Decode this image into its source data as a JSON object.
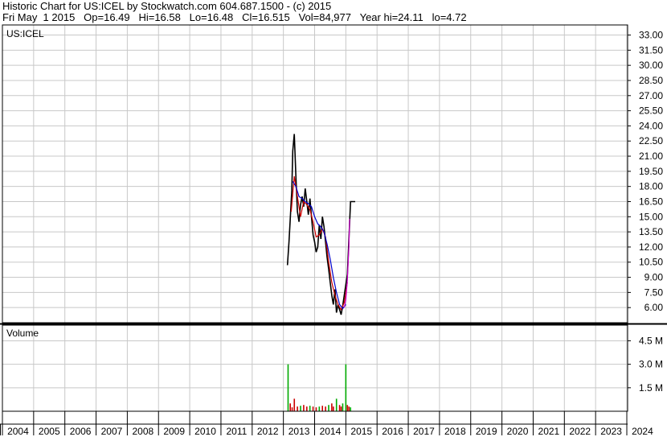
{
  "header": {
    "line1": "Historic Chart for US:ICEL by Stockwatch.com 604.687.1500 - (c) 2015",
    "line2": "Fri May  1 2015   Op=16.49   Hi=16.58   Lo=16.48   Cl=16.515   Vol=84,977   Year hi=24.11   lo=4.72"
  },
  "chart_data": [
    {
      "type": "line",
      "title": "US:ICEL",
      "ylim": [
        4.5,
        34
      ],
      "y_ticks": [
        "33.00",
        "31.50",
        "30.00",
        "28.50",
        "27.00",
        "25.50",
        "24.00",
        "22.50",
        "21.00",
        "19.50",
        "18.00",
        "16.50",
        "15.00",
        "13.50",
        "12.00",
        "10.50",
        "9.00",
        "7.50",
        "6.00"
      ],
      "x_ticks": [
        "2004",
        "2005",
        "2006",
        "2007",
        "2008",
        "2009",
        "2010",
        "2011",
        "2012",
        "2013",
        "2014",
        "2015",
        "2016",
        "2017",
        "2018",
        "2019",
        "2020",
        "2021",
        "2022",
        "2023",
        "2024"
      ],
      "series": [
        {
          "color": "#000000",
          "x": [
            2013.13,
            2013.18,
            2013.22,
            2013.27,
            2013.3,
            2013.35,
            2013.4,
            2013.45,
            2013.5,
            2013.55,
            2013.6,
            2013.65,
            2013.7,
            2013.75,
            2013.8,
            2013.85,
            2013.9,
            2013.95,
            2014.0,
            2014.05,
            2014.1,
            2014.15,
            2014.2,
            2014.25,
            2014.3,
            2014.35,
            2014.4,
            2014.45,
            2014.5,
            2014.55,
            2014.6,
            2014.65,
            2014.7,
            2014.75,
            2014.8,
            2014.85,
            2014.9,
            2015.0,
            2015.05,
            2015.15,
            2015.3
          ],
          "values": [
            10.2,
            12.5,
            14.8,
            17.6,
            21.5,
            23.2,
            19.0,
            15.5,
            14.5,
            16.2,
            17.0,
            16.0,
            17.8,
            16.5,
            15.2,
            16.8,
            15.0,
            13.2,
            12.5,
            11.5,
            12.0,
            14.2,
            12.8,
            15.0,
            14.0,
            12.5,
            11.0,
            9.8,
            8.5,
            7.2,
            6.3,
            7.8,
            5.5,
            6.3,
            5.8,
            5.3,
            6.2,
            8.3,
            9.3,
            16.5,
            16.5
          ]
        },
        {
          "color": "#cc0000",
          "x": [
            2013.25,
            2013.35,
            2013.45,
            2013.55,
            2013.65,
            2013.75,
            2013.85,
            2013.95,
            2014.05,
            2014.15,
            2014.25,
            2014.35,
            2014.45,
            2014.55,
            2014.65,
            2014.75,
            2014.85,
            2014.95,
            2015.05
          ],
          "values": [
            15.5,
            19.0,
            17.0,
            15.0,
            16.5,
            16.2,
            15.7,
            14.5,
            13.0,
            13.2,
            13.8,
            13.0,
            10.5,
            8.5,
            7.2,
            6.3,
            5.8,
            6.5,
            8.5
          ]
        },
        {
          "color": "#0000cc",
          "x": [
            2013.3,
            2013.4,
            2013.5,
            2013.6,
            2013.7,
            2013.8,
            2013.9,
            2014.0,
            2014.1,
            2014.2,
            2014.3,
            2014.4,
            2014.5,
            2014.6,
            2014.7,
            2014.8,
            2014.9,
            2015.0
          ],
          "values": [
            18.5,
            18.0,
            17.0,
            16.8,
            16.5,
            16.3,
            16.0,
            15.0,
            14.3,
            14.0,
            13.5,
            12.3,
            10.8,
            9.0,
            7.5,
            6.3,
            5.9,
            6.3
          ]
        },
        {
          "color": "#cc00cc",
          "x": [
            2014.95,
            2015.0,
            2015.05,
            2015.1,
            2015.12
          ],
          "values": [
            6.0,
            6.8,
            8.8,
            12.0,
            14.8
          ]
        }
      ]
    },
    {
      "type": "bar",
      "title": "Volume",
      "ylim": [
        0,
        5.5
      ],
      "y_ticks": [
        "4.5 M",
        "3.0 M",
        "1.5 M"
      ],
      "x": [
        2013.15,
        2013.22,
        2013.28,
        2013.35,
        2013.45,
        2013.55,
        2013.65,
        2013.75,
        2013.85,
        2013.95,
        2014.05,
        2014.15,
        2014.25,
        2014.35,
        2014.45,
        2014.55,
        2014.6,
        2014.7,
        2014.8,
        2014.85,
        2014.9,
        2015.0,
        2015.05,
        2015.1,
        2015.15
      ],
      "values": [
        3.0,
        0.5,
        0.25,
        0.8,
        0.3,
        0.35,
        0.4,
        0.3,
        0.35,
        0.3,
        0.25,
        0.3,
        0.35,
        0.3,
        0.4,
        0.5,
        0.3,
        0.8,
        0.4,
        0.3,
        0.5,
        3.0,
        0.4,
        0.3,
        0.25
      ],
      "colors": [
        "#00aa00",
        "#cc0000",
        "#cc0000",
        "#cc0000",
        "#cc0000",
        "#00aa00",
        "#cc0000",
        "#cc0000",
        "#00aa00",
        "#cc0000",
        "#cc0000",
        "#00aa00",
        "#cc0000",
        "#cc0000",
        "#00aa00",
        "#cc0000",
        "#cc0000",
        "#00aa00",
        "#cc0000",
        "#cc0000",
        "#00aa00",
        "#00aa00",
        "#cc0000",
        "#cc0000",
        "#00aa00"
      ]
    }
  ]
}
